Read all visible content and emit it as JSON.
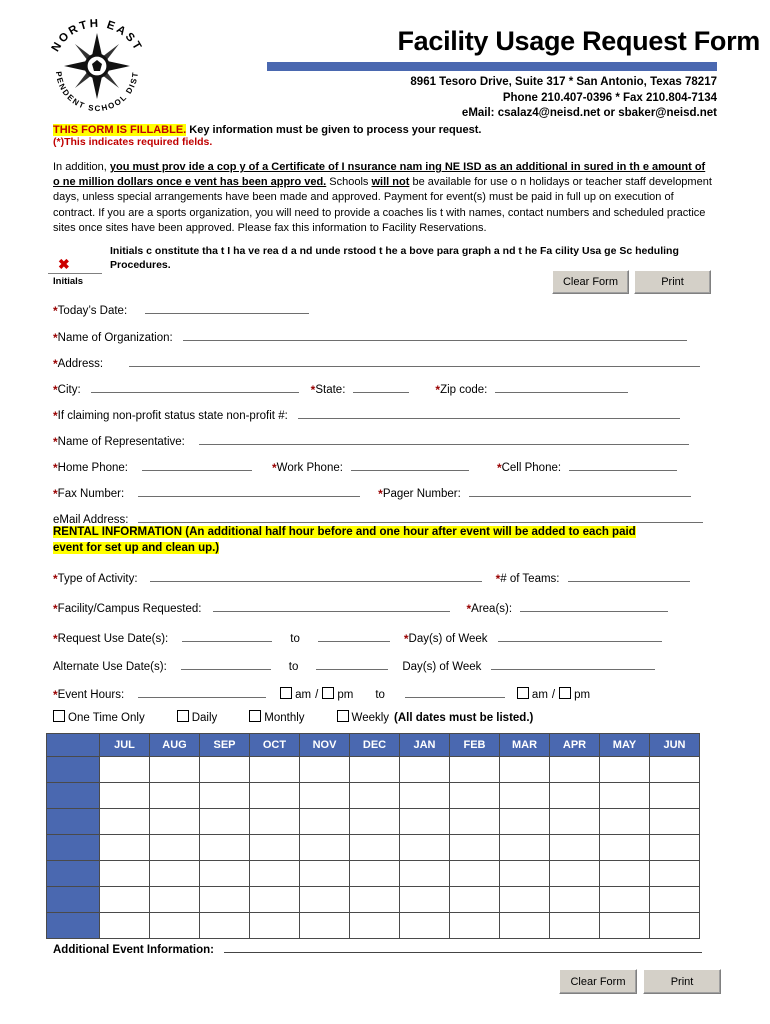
{
  "header": {
    "title": "Facility Usage Request Form",
    "logo_icon": "neisd-compass-logo",
    "logo_text_top": "NORTH EAST",
    "logo_text_bottom": "INDEPENDENT SCHOOL DISTRICT",
    "address_line1": "8961 Tesoro Drive, Suite 317 * San Antonio, Texas 78217",
    "address_line2": "Phone 210.407-0396 * Fax 210.804-7134",
    "address_line3": "eMail:  csalaz4@neisd.net or sbaker@neisd.net",
    "accent_color": "#4a68b0",
    "required_color": "#990000",
    "highlight_color": "#ffff00"
  },
  "notices": {
    "fillable_highlight": "THIS FORM IS FILLABLE.",
    "fillable_rest": "  Key information must be given to process your request.",
    "required_note": "(*)This indicates required fields."
  },
  "paragraph": {
    "lead": "In addition,",
    "bold_underline": "you must prov ide a cop y of a Certificate of I nsurance nam ing NE ISD as an additional   in sured in th e amount of o ne million dollars once e vent has been  appro ved.",
    "mid1": "Schools",
    "bold_will_not": "will not",
    "mid2": "be available for use o  n holidays or teacher staff development days, unless special arrangements have been made and approved.  Payment for event(s) must be paid in full up on execution of contract.  If you are a sports organization, you   will need to provide a coaches lis t with names, contact numbers and scheduled practice sites once sites have been approved.  Please fax this information to Facility Reservations."
  },
  "initials": {
    "statement": "Initials c onstitute tha t I ha ve rea d a nd unde rstood t he a bove para graph a nd t he Fa cility Usa ge Sc heduling Procedures.",
    "mark": "✖",
    "caption": "Initials"
  },
  "buttons": {
    "clear_form": "Clear Form",
    "print": "Print"
  },
  "fields": {
    "todays_date": "*Today’s Date:",
    "name_of_organization": "*Name of Organization:",
    "address": "*Address:",
    "city": "*City:",
    "state": "*State:",
    "zip_code": "*Zip code:",
    "non_profit": "*If claiming non-profit status state non-profit #:",
    "name_of_representative": "*Name of Representative:",
    "home_phone": "*Home Phone:",
    "work_phone": "*Work Phone:",
    "cell_phone": "*Cell Phone:",
    "fax_number": "*Fax Number:",
    "pager_number": "*Pager Number:",
    "email_address": "eMail Address:",
    "type_of_activity": "*Type of Activity:",
    "num_of_teams": "*# of Teams:",
    "facility_campus": "*Facility/Campus Requested:",
    "areas": "*Area(s):",
    "request_use_dates": "*Request Use Date(s):",
    "to": "to",
    "days_of_week": "*Day(s) of Week",
    "alternate_use_dates": "Alternate Use Date(s):",
    "alt_days_of_week": "Day(s) of Week",
    "event_hours": "*Event Hours:",
    "am": "am",
    "slash": "/",
    "pm": "pm",
    "additional_event_information": "Additional Event Information:"
  },
  "rental_information": {
    "line1": "RENTAL INFORMATION  (An additional half hour before and one hour after event will be added to each paid",
    "line2": "event for set up and clean up.)"
  },
  "frequency": {
    "one_time_only": "One Time Only",
    "daily": "Daily",
    "monthly": "Monthly",
    "weekly": "Weekly",
    "weekly_note": "(All dates must be listed.)"
  },
  "month_table": {
    "columns": [
      "JUL",
      "AUG",
      "SEP",
      "OCT",
      "NOV",
      "DEC",
      "JAN",
      "FEB",
      "MAR",
      "APR",
      "MAY",
      "JUN"
    ],
    "row_count": 7,
    "header_bg": "#4a68b0",
    "rowhead_bg": "#4a68b0"
  }
}
